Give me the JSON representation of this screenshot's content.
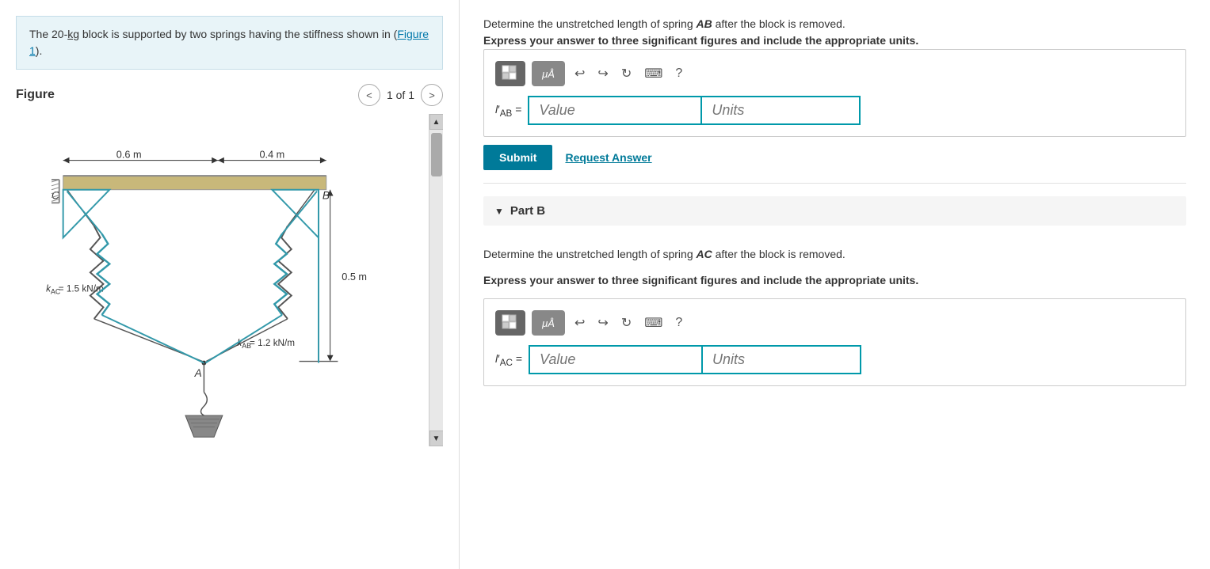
{
  "left": {
    "description": "The 20-kg block is supported by two springs having the stiffness shown in (Figure 1).",
    "figure_link": "Figure 1",
    "figure_label": "Figure",
    "page_indicator": "1 of 1",
    "nav_prev": "<",
    "nav_next": ">"
  },
  "right": {
    "part_a": {
      "description1": "Determine the unstretched length of spring ",
      "spring_a": "AB",
      "description2": " after the block is removed.",
      "instruction": "Express your answer to three significant figures and include the appropriate units.",
      "toolbar": {
        "matrix_icon": "⊞",
        "mu_label": "μÅ",
        "undo": "↩",
        "redo": "↪",
        "refresh": "↻",
        "keyboard": "⌨",
        "help": "?"
      },
      "input_label": "l′AB =",
      "value_placeholder": "Value",
      "units_placeholder": "Units",
      "submit_label": "Submit",
      "request_answer_label": "Request Answer"
    },
    "part_b": {
      "label": "Part B",
      "description1": "Determine the unstretched length of spring ",
      "spring_b": "AC",
      "description2": " after the block is removed.",
      "instruction": "Express your answer to three significant figures and include the appropriate units.",
      "toolbar": {
        "matrix_icon": "⊞",
        "mu_label": "μÅ",
        "undo": "↩",
        "redo": "↪",
        "refresh": "↻",
        "keyboard": "⌨",
        "help": "?"
      },
      "input_label": "l′AC =",
      "value_placeholder": "Value",
      "units_placeholder": "Units"
    }
  }
}
